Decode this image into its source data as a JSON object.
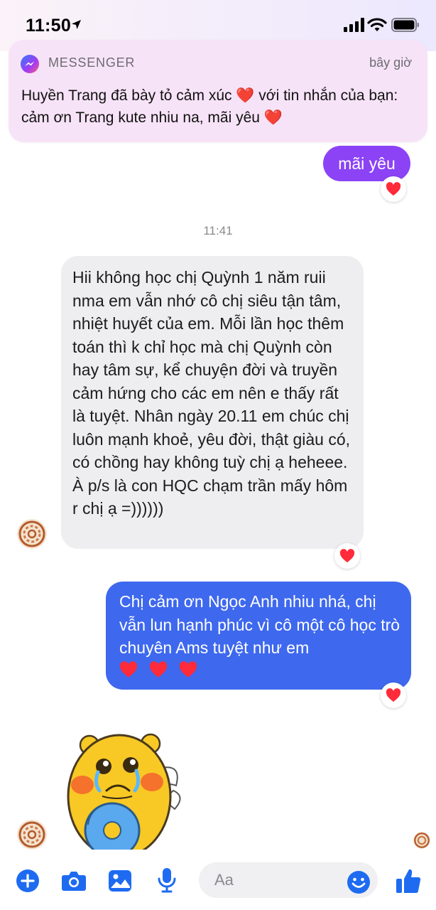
{
  "status_bar": {
    "time": "11:50"
  },
  "notification": {
    "app": "MESSENGER",
    "time": "bây giờ",
    "body": "Huyền Trang đã bày tỏ cảm xúc ❤️ với tin nhắn của bạn: cảm ơn Trang kute nhiu na, mãi yêu ❤️"
  },
  "messages": [
    {
      "direction": "outgoing",
      "text": "mãi yêu",
      "reaction": "❤️"
    },
    {
      "type": "timestamp",
      "text": "11:41"
    },
    {
      "direction": "incoming",
      "text": "Hii không học chị Quỳnh 1 năm ruii nma em vẫn nhớ cô chị siêu tận tâm, nhiệt huyết của em. Mỗi lần học thêm toán thì k chỉ học mà chị Quỳnh còn hay tâm sự, kể chuyện đời và truyền cảm hứng cho các em nên e thấy rất là tuyệt. Nhân ngày 20.11 em chúc chị luôn mạnh khoẻ, yêu đời, thật giàu có, có chồng hay không tuỳ chị ạ heheee. À p/s là con HQC chạm trần mấy hôm r chị ạ =))))))",
      "reaction": "❤️"
    },
    {
      "direction": "outgoing",
      "text": "Chị cảm ơn Ngọc Anh nhiu nhá, chị vẫn lun hạnh phúc vì cô một cô học trò chuyên Ams tuyệt như em",
      "emoji_row": "❤️ ❤️ ❤️",
      "reaction": "❤️"
    },
    {
      "direction": "incoming",
      "type": "sticker",
      "sticker": "crying-yellow-bear-sticker"
    }
  ],
  "composer": {
    "placeholder": "Aa"
  },
  "colors": {
    "outgoing_purple": "#8b43f5",
    "outgoing_blue": "#3e68ee",
    "incoming_gray": "#eeeef0",
    "accent_blue": "#1e6bf1",
    "heart_red": "#ff2a3a"
  },
  "icons": [
    "location-arrow-icon",
    "signal-icon",
    "wifi-icon",
    "battery-icon",
    "messenger-logo-icon",
    "heart-icon",
    "plus-icon",
    "camera-icon",
    "image-icon",
    "microphone-icon",
    "smile-icon",
    "thumbs-up-icon"
  ]
}
